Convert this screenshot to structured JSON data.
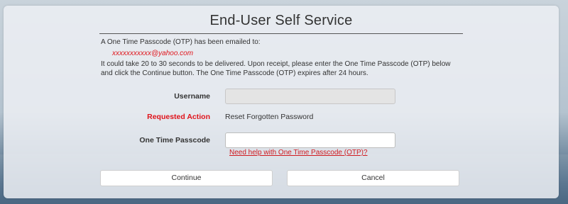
{
  "page": {
    "title": "End-User Self Service"
  },
  "message": {
    "line1": "A One Time Passcode (OTP) has been emailed to:",
    "email": "xxxxxxxxxxx@yahoo.com",
    "line2": "It could take 20 to 30 seconds to be delivered. Upon receipt, please enter the One Time Passcode (OTP) below",
    "line3": "and click the Continue button. The One Time Passcode (OTP) expires after 24 hours."
  },
  "form": {
    "username_label": "Username",
    "username_value": "",
    "requested_action_label": "Requested Action",
    "requested_action_value": "Reset Forgotten Password",
    "otp_label": "One Time Passcode",
    "otp_value": "",
    "help_link": "Need help with One Time Passcode (OTP)?"
  },
  "buttons": {
    "continue_label": "Continue",
    "cancel_label": "Cancel"
  },
  "colors": {
    "accent_red": "#e0141b",
    "panel_bg": "#eceff3"
  }
}
